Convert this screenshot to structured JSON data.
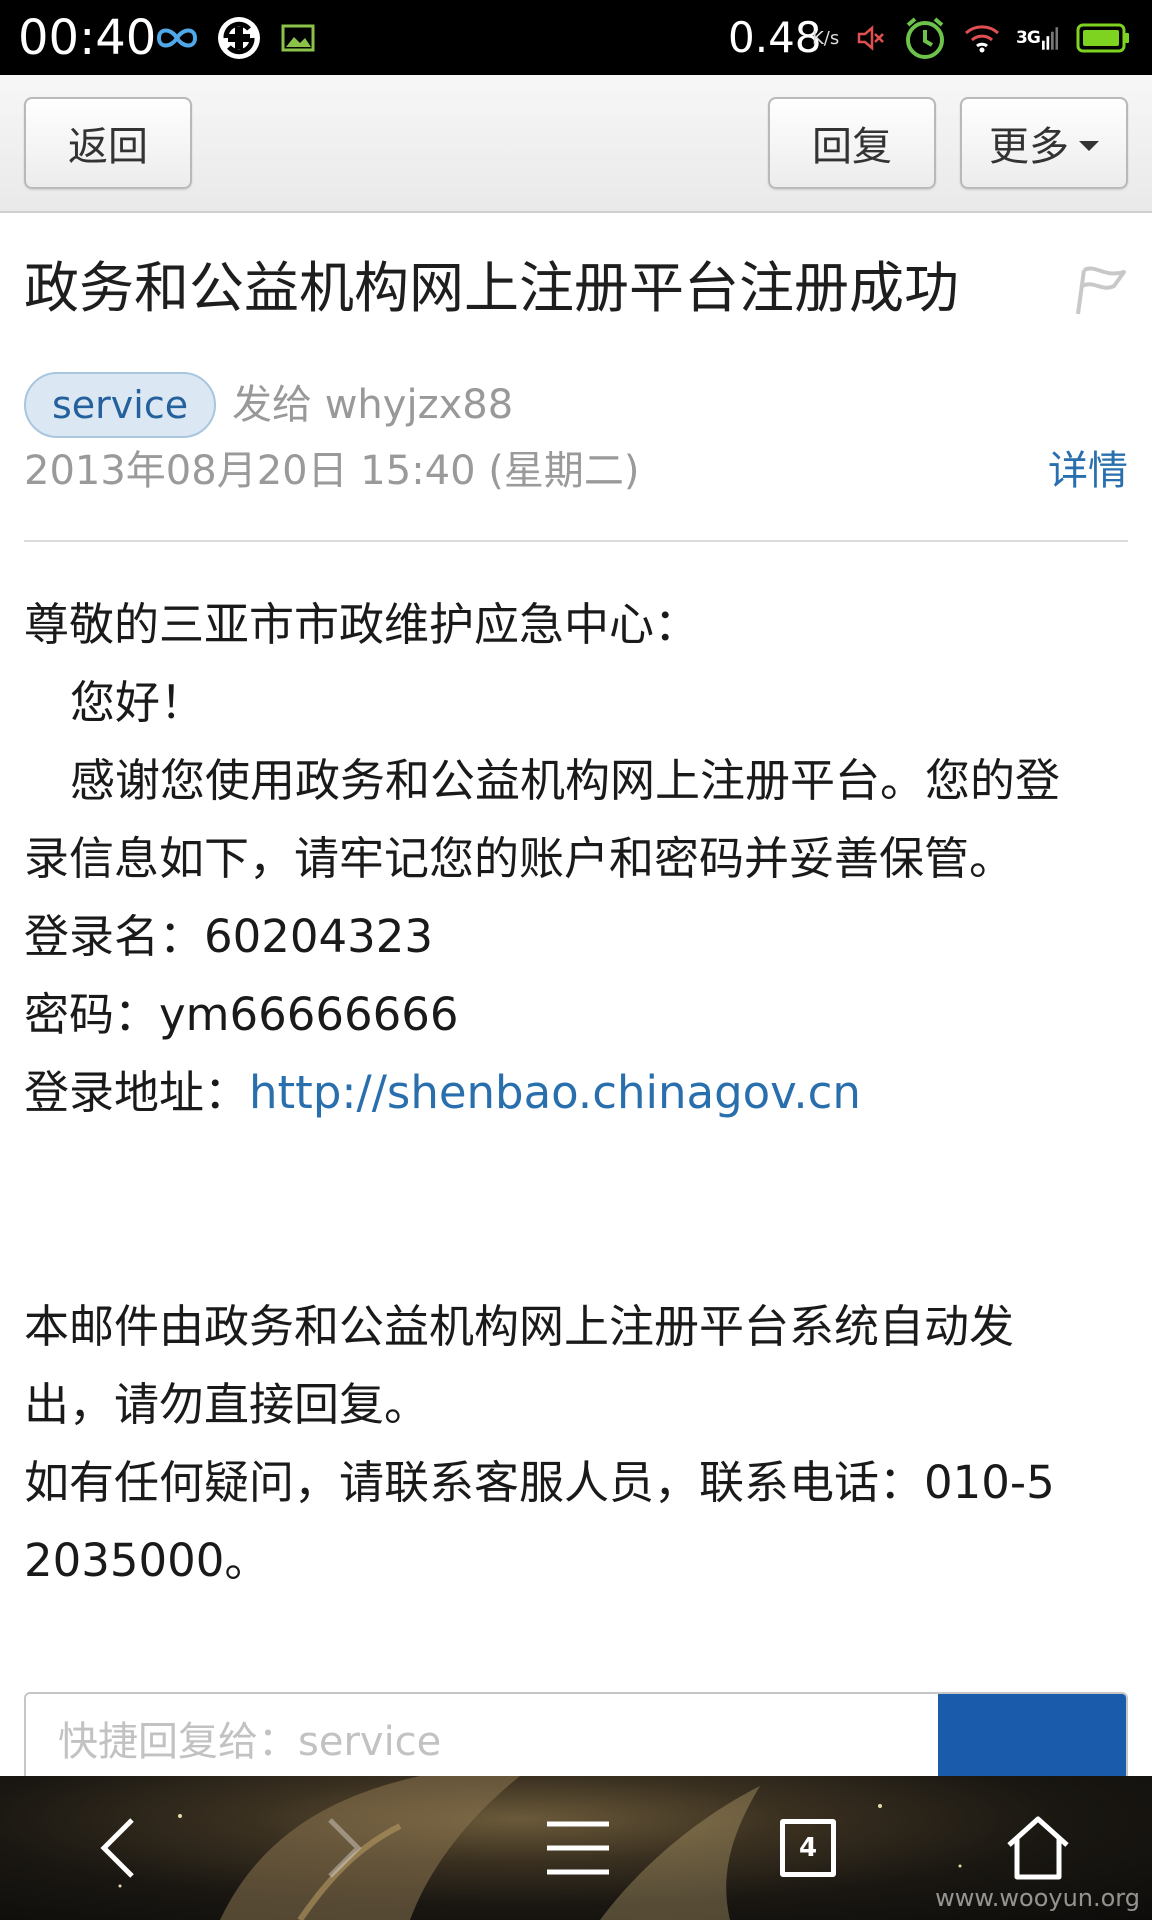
{
  "status_bar": {
    "time": "00:40",
    "net_speed": "0.48",
    "net_speed_unit": "K/s",
    "icons": [
      "infinity-icon",
      "sync-icon",
      "image-icon",
      "mute-icon",
      "alarm-icon",
      "wifi-icon",
      "3g-signal-icon",
      "battery-icon"
    ],
    "network_label": "3G",
    "battery_color": "#7ed321"
  },
  "toolbar": {
    "back_label": "返回",
    "reply_label": "回复",
    "more_label": "更多"
  },
  "email": {
    "subject": "政务和公益机构网上注册平台注册成功",
    "sender": "service",
    "sendto_prefix": "发给",
    "recipient": "whyjzx88",
    "date": "2013年08月20日 15:40 (星期二)",
    "details_label": "详情"
  },
  "body": {
    "greeting": "尊敬的三亚市市政维护应急中心：",
    "hello": "您好！",
    "para1_line1": "感谢您使用政务和公益机构网上注册平台。您的登",
    "para1_line2": "录信息如下，请牢记您的账户和密码并妥善保管。",
    "login_name_label": "登录名：",
    "login_name": "60204323",
    "password_label": "密码：",
    "password": "ym66666666",
    "login_url_label": "登录地址：",
    "login_url": "http://shenbao.chinagov.cn",
    "footer1_line1": "本邮件由政务和公益机构网上注册平台系统自动发",
    "footer1_line2": "出，请勿直接回复。",
    "footer2_line1": "如有任何疑问，请联系客服人员，联系电话：010-5",
    "footer2_line2": "2035000。"
  },
  "quick_reply": {
    "placeholder": "快捷回复给：service"
  },
  "bottom_nav": {
    "tab_count": "4",
    "watermark": "www.wooyun.org"
  },
  "colors": {
    "accent": "#2a6fad",
    "send_button": "#1a5cab",
    "status_bar": "#000000"
  }
}
